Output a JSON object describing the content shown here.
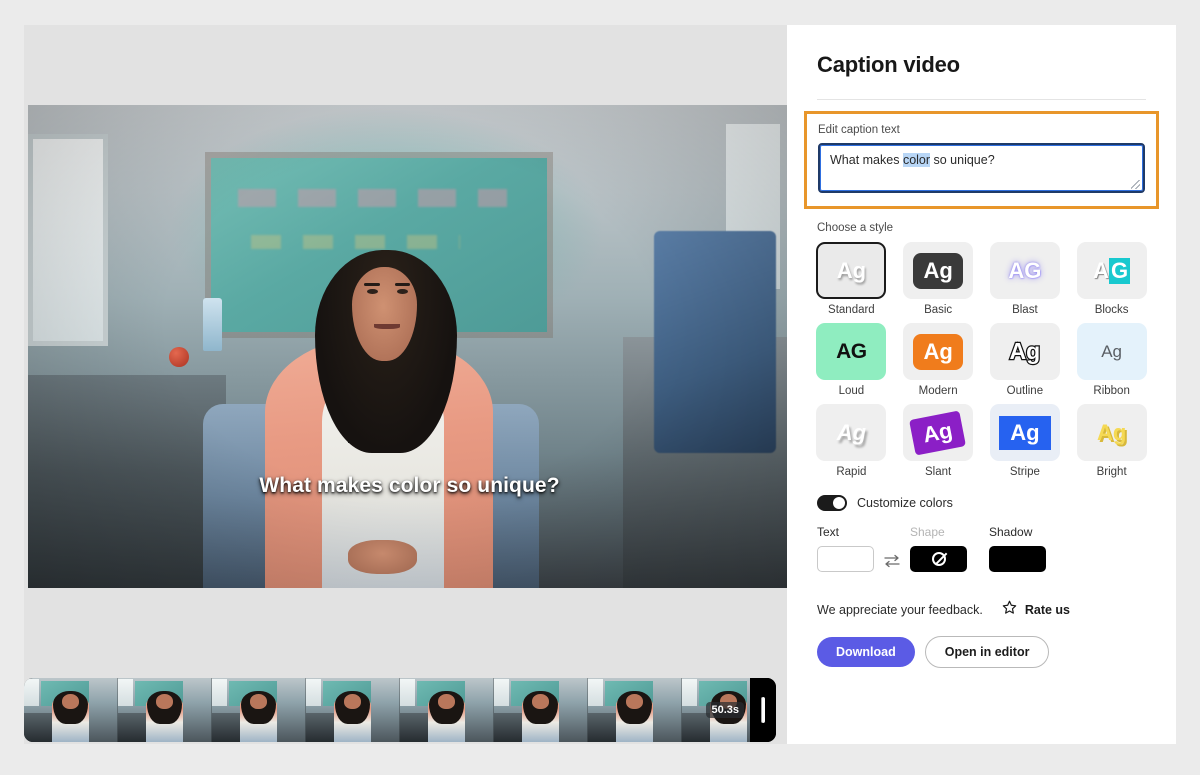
{
  "panel": {
    "title": "Caption video",
    "edit_field": {
      "label": "Edit caption text",
      "value_before": "What makes ",
      "value_selected": "color",
      "value_after": " so unique?",
      "full_value": "What makes color so unique?"
    },
    "styles_label": "Choose a style",
    "styles": [
      {
        "name": "Standard",
        "sample": "Ag",
        "selected": true
      },
      {
        "name": "Basic",
        "sample": "Ag",
        "selected": false
      },
      {
        "name": "Blast",
        "sample": "AG",
        "selected": false
      },
      {
        "name": "Blocks",
        "sample_a": "A",
        "sample_b": "G",
        "selected": false
      },
      {
        "name": "Loud",
        "sample": "AG",
        "selected": false
      },
      {
        "name": "Modern",
        "sample": "Ag",
        "selected": false
      },
      {
        "name": "Outline",
        "sample": "Ag",
        "selected": false
      },
      {
        "name": "Ribbon",
        "sample": "Ag",
        "selected": false
      },
      {
        "name": "Rapid",
        "sample": "Ag",
        "selected": false
      },
      {
        "name": "Slant",
        "sample": "Ag",
        "selected": false
      },
      {
        "name": "Stripe",
        "sample": "Ag",
        "selected": false
      },
      {
        "name": "Bright",
        "sample": "Ag",
        "selected": false
      }
    ],
    "customize": {
      "toggle_label": "Customize colors",
      "toggle_on": true,
      "text_label": "Text",
      "shape_label": "Shape",
      "shadow_label": "Shadow",
      "text_color": "#ffffff",
      "shape_color": "none",
      "shadow_color": "#000000",
      "swap_icon": "swap-arrows-icon"
    },
    "feedback": {
      "text": "We appreciate your feedback.",
      "rate_label": "Rate us",
      "rate_icon": "star-outline-icon"
    },
    "actions": {
      "primary": "Download",
      "secondary": "Open in editor"
    }
  },
  "player": {
    "caption_overlay": "What makes color so unique?",
    "duration_label": "50.3s",
    "trim_handle": "trim-handle-right"
  },
  "colors": {
    "accent_orange": "#e8962a",
    "primary_button": "#5b5be5",
    "selection_blue": "#b8d6f6",
    "input_border": "#1f3a68",
    "page_bg": "#ebebeb",
    "stage_bg": "#e2e2e2"
  }
}
